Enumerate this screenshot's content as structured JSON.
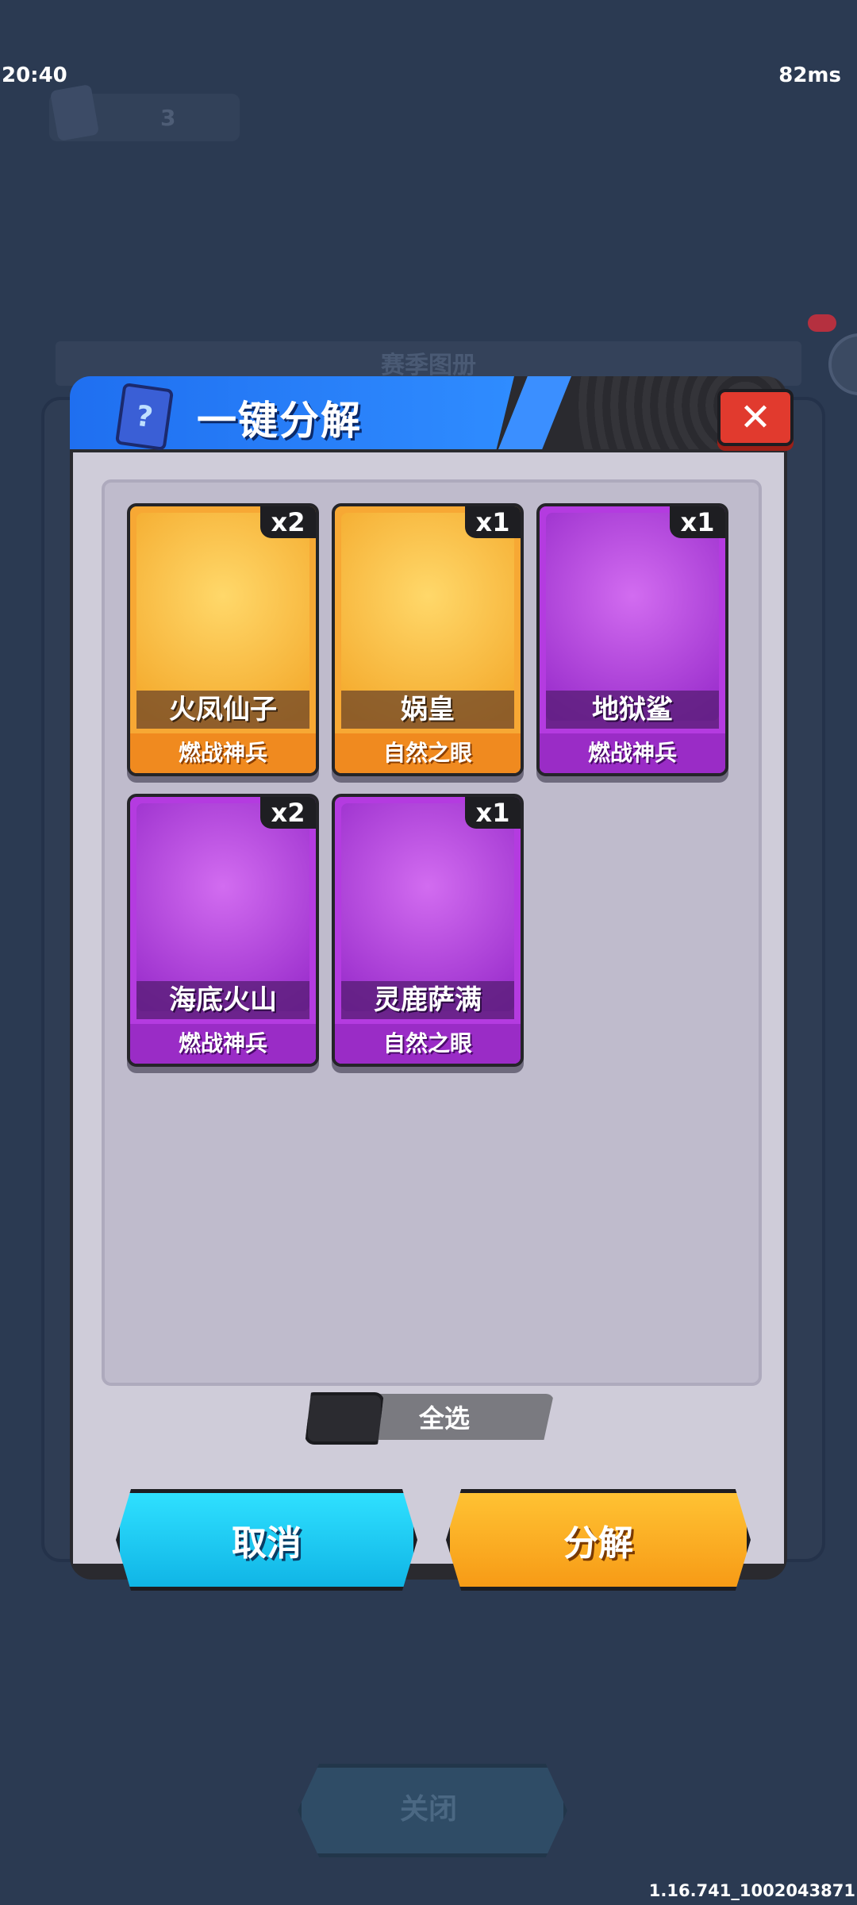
{
  "status_bar": {
    "time": "20:40",
    "ping": "82ms"
  },
  "background": {
    "counter_value": "3",
    "album_title": "赛季图册",
    "close_label": "关闭"
  },
  "dialog": {
    "title": "一键分解",
    "close_symbol": "✕",
    "card_icon_symbol": "?",
    "cards": [
      {
        "name": "火凤仙子",
        "faction": "燃战神兵",
        "count": "x2",
        "rarity": "orange"
      },
      {
        "name": "娲皇",
        "faction": "自然之眼",
        "count": "x1",
        "rarity": "orange"
      },
      {
        "name": "地狱鲨",
        "faction": "燃战神兵",
        "count": "x1",
        "rarity": "purple"
      },
      {
        "name": "海底火山",
        "faction": "燃战神兵",
        "count": "x2",
        "rarity": "purple"
      },
      {
        "name": "灵鹿萨满",
        "faction": "自然之眼",
        "count": "x1",
        "rarity": "purple"
      }
    ],
    "select_all_label": "全选",
    "cancel_label": "取消",
    "confirm_label": "分解"
  },
  "version": "1.16.741_1002043871",
  "colors": {
    "background": "#2b3a52",
    "orange_card": "#f7a834",
    "purple_card": "#b43be0",
    "cancel_button": "#10b5e6",
    "confirm_button": "#f79b16",
    "close_button": "#e13a2e",
    "header_blue": "#2f8cff"
  }
}
